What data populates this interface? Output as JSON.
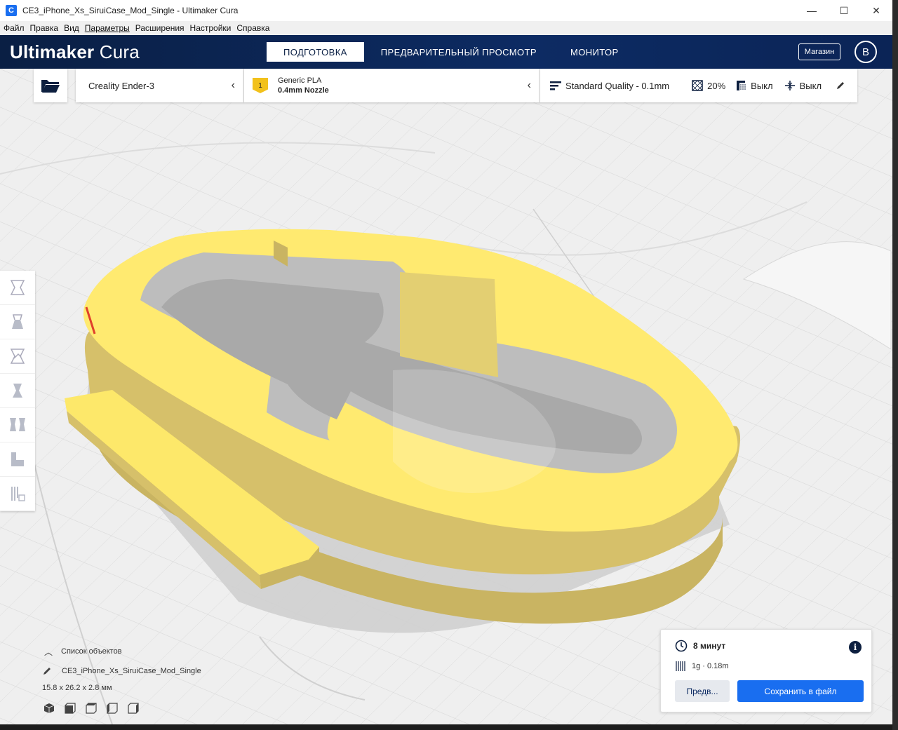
{
  "window": {
    "title": "CE3_iPhone_Xs_SiruiCase_Mod_Single - Ultimaker Cura",
    "app_icon": "C",
    "minimize_glyph": "—",
    "maximize_glyph": "☐",
    "close_glyph": "✕"
  },
  "menu": [
    "Файл",
    "Правка",
    "Вид",
    "Параметры",
    "Расширения",
    "Настройки",
    "Справка"
  ],
  "header": {
    "logo_bold": "Ultimaker",
    "logo_light": " Cura",
    "tabs": [
      "ПОДГОТОВКА",
      "ПРЕДВАРИТЕЛЬНЫЙ ПРОСМОТР",
      "МОНИТОР"
    ],
    "active_tab": 0,
    "market_label": "Магазин",
    "account_initial": "B"
  },
  "printer": {
    "name": "Creality Ender-3"
  },
  "material": {
    "badge": "1",
    "name": "Generic PLA",
    "nozzle": "0.4mm Nozzle",
    "color": "#f2c11b"
  },
  "settings": {
    "profile": "Standard Quality - 0.1mm",
    "infill": "20%",
    "support": "Выкл",
    "adhesion": "Выкл"
  },
  "object_list": {
    "title": "Список объектов",
    "object_name": "CE3_iPhone_Xs_SiruiCase_Mod_Single",
    "dimensions": "15.8 x 26.2 x 2.8 мм"
  },
  "print_panel": {
    "time": "8 минут",
    "material_usage": "1g · 0.18m",
    "info_glyph": "i",
    "preview_label": "Предв...",
    "save_label": "Сохранить в файл"
  },
  "colors": {
    "header_bg": "#0a1f44",
    "accent": "#196ef0",
    "model_top": "#ffe96a",
    "model_side": "#d9c46a"
  },
  "icons": {
    "tools": [
      "move-icon",
      "scale-icon",
      "rotate-icon",
      "mirror-icon",
      "per-model-settings-icon",
      "support-blocker-icon",
      "multiply-icon"
    ],
    "views": [
      "3d-view-icon",
      "front-view-icon",
      "top-view-icon",
      "left-view-icon",
      "right-view-icon"
    ]
  }
}
